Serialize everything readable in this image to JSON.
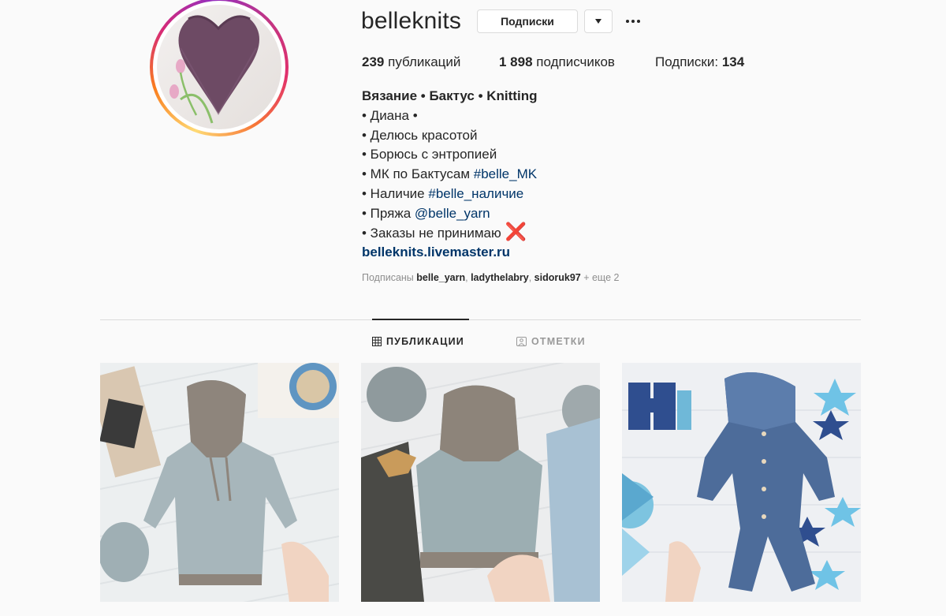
{
  "profile": {
    "username": "belleknits",
    "following_button": "Подписки"
  },
  "stats": {
    "posts_count": "239",
    "posts_label": "публикаций",
    "followers_count": "1 898",
    "followers_label": "подписчиков",
    "following_label": "Подписки:",
    "following_count": "134"
  },
  "bio": {
    "title": "Вязание • Бактус • Knitting",
    "line1": "• Диана •",
    "line2": "• Делюсь красотой",
    "line3": "• Борюсь с энтропией",
    "line4_text": "• МК по Бактусам ",
    "line4_tag": "#belle_MK",
    "line5_text": "• Наличие ",
    "line5_tag": "#belle_наличие",
    "line6_text": "• Пряжа ",
    "line6_mention": "@belle_yarn",
    "line7_text": "• Заказы не принимаю ",
    "line7_emoji": "❌",
    "website": "belleknits.livemaster.ru"
  },
  "followed_by": {
    "prefix": "Подписаны ",
    "users": [
      "belle_yarn",
      "ladythelabry",
      "sidoruk97"
    ],
    "suffix": " + еще 2"
  },
  "tabs": [
    {
      "label": "ПУБЛИКАЦИИ",
      "icon": "grid-icon",
      "active": true
    },
    {
      "label": "ОТМЕТКИ",
      "icon": "tagged-person-icon",
      "active": false
    }
  ],
  "colors": {
    "link": "#003569",
    "text": "#262626",
    "muted": "#8e8e8e",
    "divider": "#dbdbdb",
    "background": "#fafafa"
  }
}
